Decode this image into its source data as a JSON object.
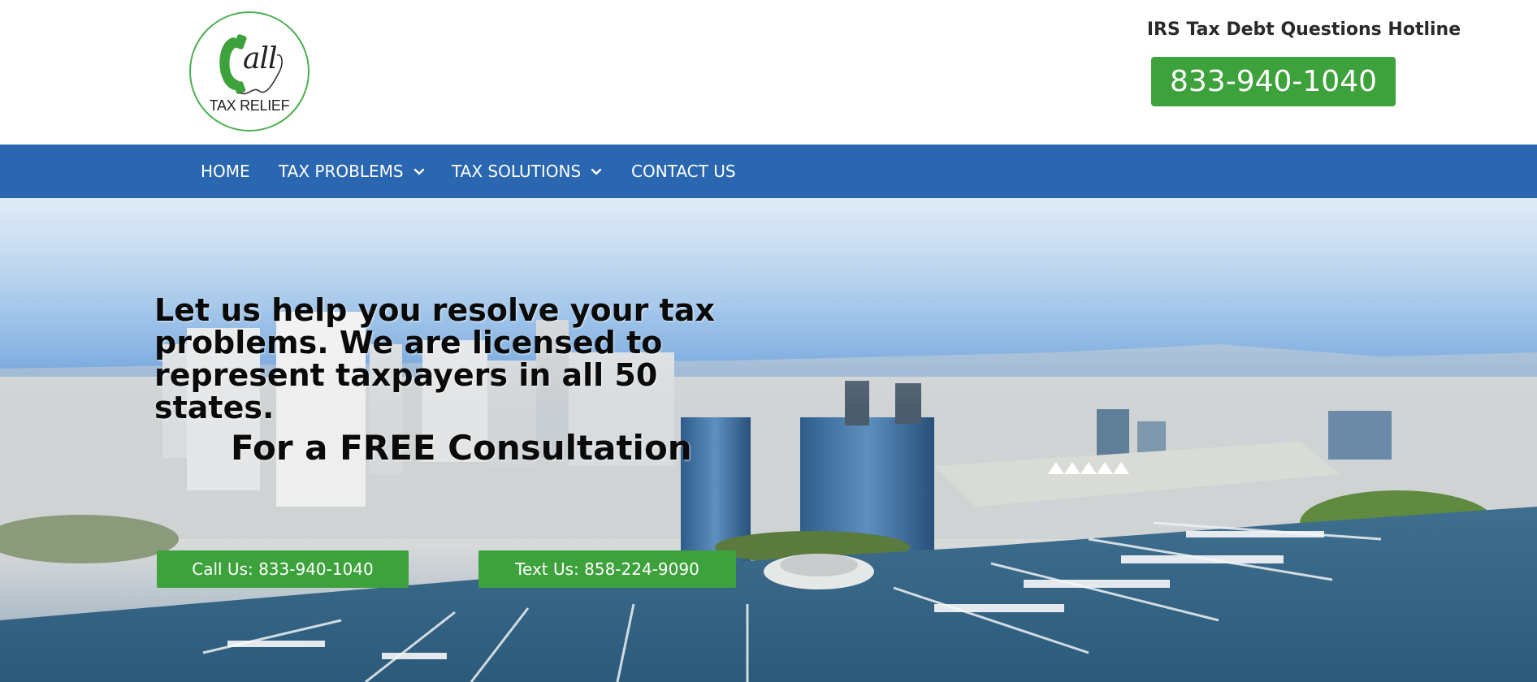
{
  "header": {
    "logo": {
      "wordmark": "all",
      "subtitle": "TAX RELIEF",
      "brand_color": "#4caf50"
    },
    "hotline_title": "IRS Tax Debt Questions Hotline",
    "hotline_phone": "833-940-1040",
    "accent_color": "#3ea23c"
  },
  "nav": {
    "background_color": "#2a67b0",
    "items": [
      {
        "label": "HOME",
        "has_dropdown": false
      },
      {
        "label": "TAX PROBLEMS",
        "has_dropdown": true,
        "icon": "chevron-down-icon"
      },
      {
        "label": "TAX SOLUTIONS",
        "has_dropdown": true,
        "icon": "chevron-down-icon"
      },
      {
        "label": "CONTACT US",
        "has_dropdown": false
      }
    ]
  },
  "hero": {
    "headline": "Let us help you resolve your tax problems. We are licensed to represent taxpayers in all 50 states.",
    "subheadline": "For a FREE Consultation",
    "buttons": {
      "call_label": "Call Us: 833-940-1040",
      "text_label": "Text Us: 858-224-9090"
    },
    "background": "aerial-city-marina-photo"
  }
}
